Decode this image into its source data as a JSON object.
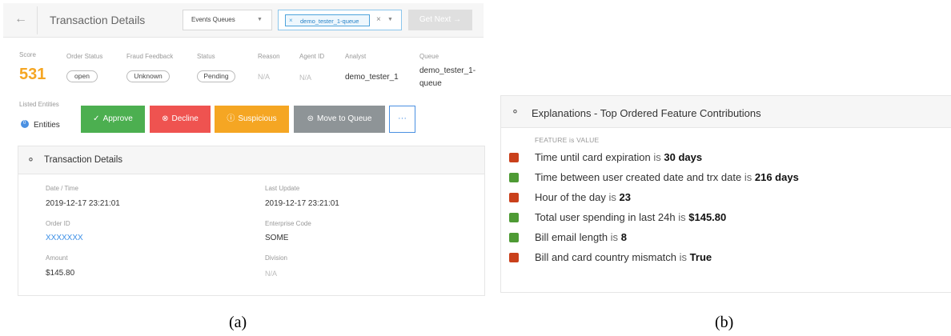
{
  "panel_a": {
    "topbar": {
      "title": "Transaction Details",
      "queue_select": "Events Queues",
      "queue_tag": "demo_tester_1-queue",
      "get_next": "Get Next →"
    },
    "summary": {
      "score_label": "Score",
      "score": "531",
      "order_status_label": "Order Status",
      "order_status": "open",
      "fraud_feedback_label": "Fraud Feedback",
      "fraud_feedback": "Unknown",
      "status_label": "Status",
      "status": "Pending",
      "reason_label": "Reason",
      "reason": "N/A",
      "agent_id_label": "Agent ID",
      "agent_id": "N/A",
      "analyst_label": "Analyst",
      "analyst": "demo_tester_1",
      "queue_label": "Queue",
      "queue": "demo_tester_1-queue"
    },
    "entities": {
      "label": "Listed Entities",
      "count": "0",
      "name": "Entities"
    },
    "actions": {
      "approve": "Approve",
      "decline": "Decline",
      "suspicious": "Suspicious",
      "move_to_queue": "Move to Queue",
      "more": "···"
    },
    "details": {
      "title": "Transaction Details",
      "date_time_label": "Date / Time",
      "date_time": "2019-12-17 23:21:01",
      "last_update_label": "Last Update",
      "last_update": "2019-12-17 23:21:01",
      "order_id_label": "Order ID",
      "order_id": "XXXXXXX",
      "enterprise_code_label": "Enterprise Code",
      "enterprise_code": "SOME",
      "amount_label": "Amount",
      "amount": "$145.80",
      "division_label": "Division",
      "division": "N/A"
    },
    "caption": "(a)"
  },
  "panel_b": {
    "title": "Explanations - Top Ordered Feature Contributions",
    "column_header": "FEATURE is VALUE",
    "connector": "is",
    "features": [
      {
        "feature": "Time until card expiration",
        "value": "30 days",
        "color": "#c9401b"
      },
      {
        "feature": "Time between user created date and trx date",
        "value": "216 days",
        "color": "#4e9a34"
      },
      {
        "feature": "Hour of the day",
        "value": "23",
        "color": "#c9401b"
      },
      {
        "feature": "Total user spending in last 24h",
        "value": "$145.80",
        "color": "#4e9a34"
      },
      {
        "feature": "Bill email length",
        "value": "8",
        "color": "#4e9a34"
      },
      {
        "feature": "Bill and card country mismatch",
        "value": "True",
        "color": "#c9401b"
      }
    ],
    "caption": "(b)"
  },
  "colors": {
    "approve": "#4caf50",
    "decline": "#ef5350",
    "suspicious": "#f5a623",
    "move_to_queue": "#8e9497",
    "score": "#f5a623",
    "link": "#3a8ee6"
  }
}
